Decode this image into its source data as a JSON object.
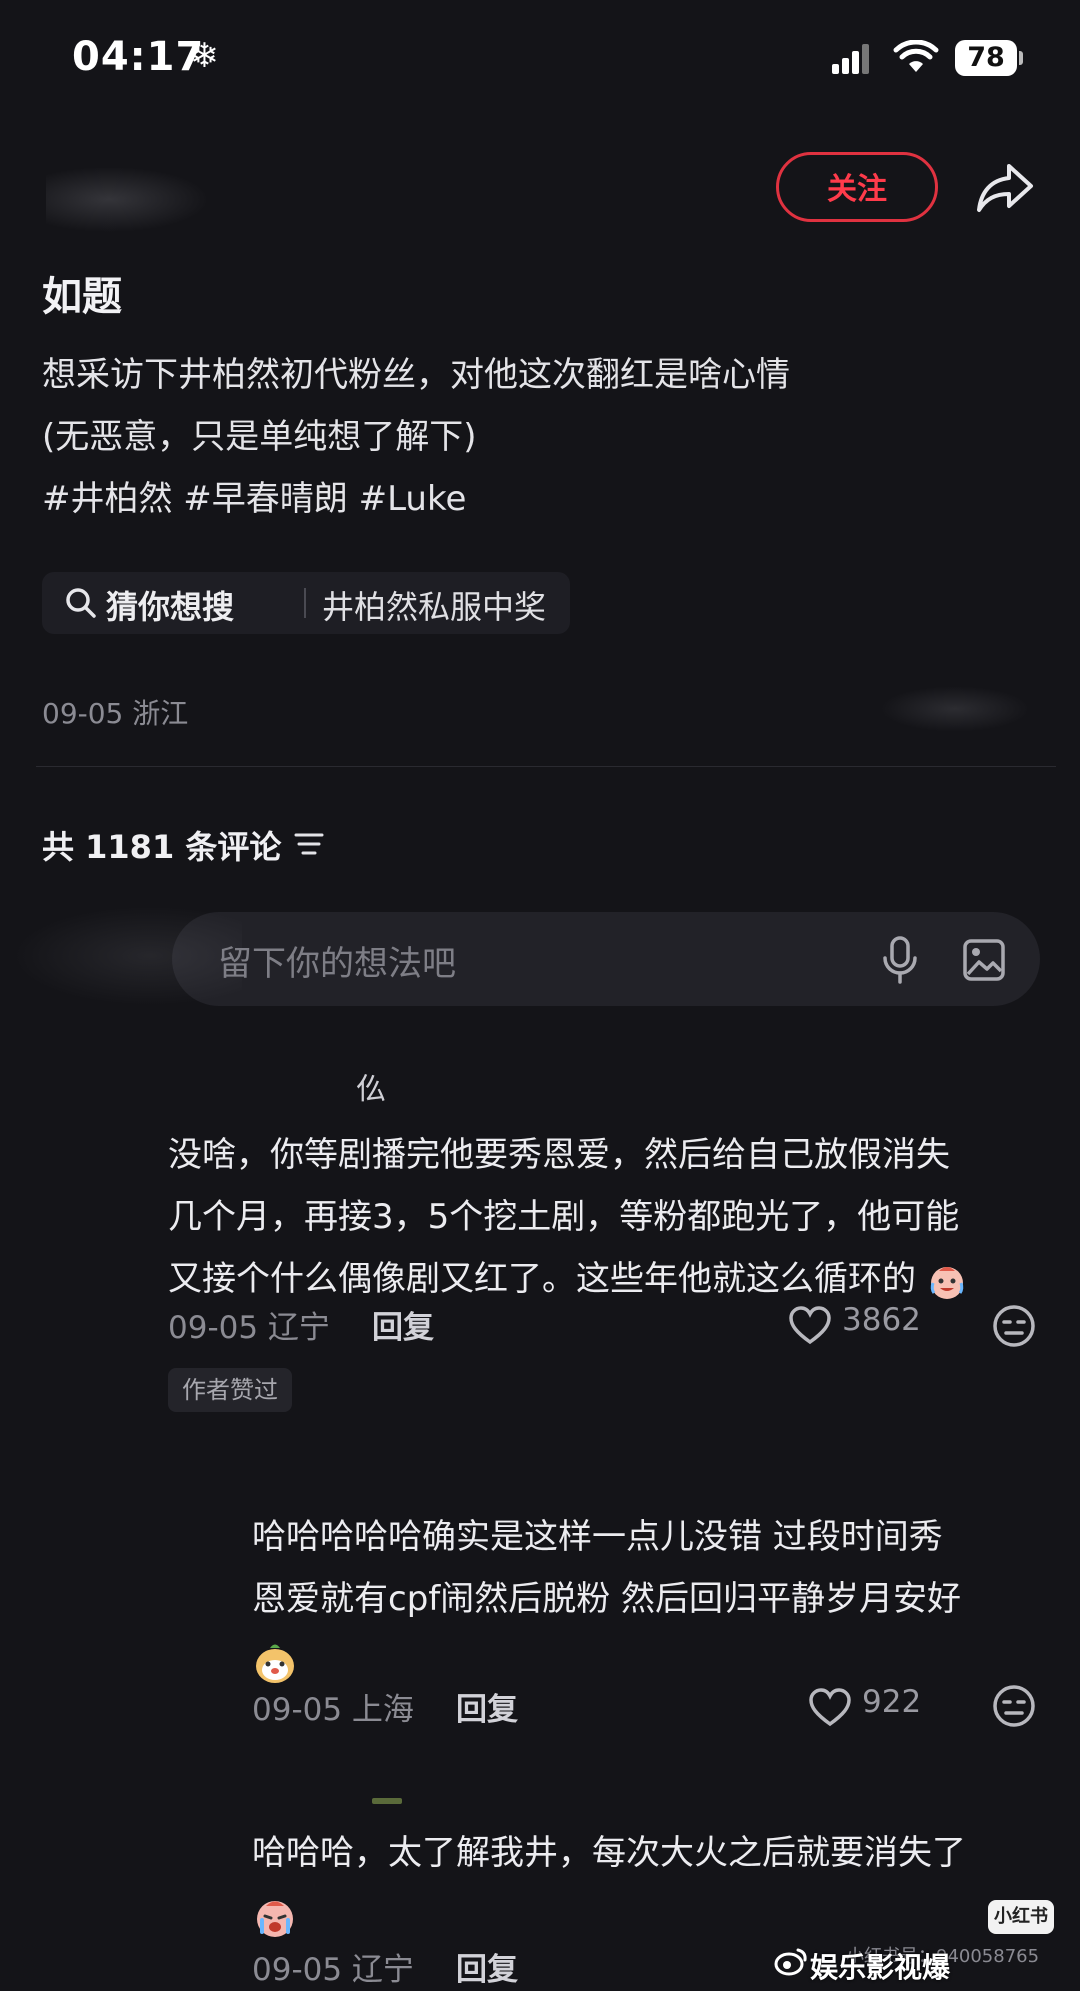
{
  "status_bar": {
    "time": "04:17",
    "snow_glyph": "❄",
    "battery": "78"
  },
  "header": {
    "follow_label": "关注",
    "share_icon": "share-arrow-icon"
  },
  "post": {
    "title": "如题",
    "body_lines": [
      "想采访下井柏然初代粉丝，对他这次翻红是啥心情",
      "(无恶意，只是单纯想了解下)",
      "#井柏然 #早春晴朗 #Luke"
    ],
    "search_chip": {
      "label": "猜你想搜",
      "term": "井柏然私服中奖"
    },
    "date_location": "09-05 浙江"
  },
  "comments_section": {
    "count_label": "共 1181 条评论",
    "input_placeholder": "留下你的想法吧"
  },
  "comments": [
    {
      "username": "仫",
      "text_lines": [
        "没啥，你等剧播完他要秀恩爱，然后给自己放假消失",
        "几个月，再接3，5个挖土剧，等粉都跑光了，他可能",
        "又接个什么偶像剧又红了。这些年他就这么循环的"
      ],
      "date_location": "09-05 辽宁",
      "reply_label": "回复",
      "likes": "3862",
      "badge": "作者赞过"
    },
    {
      "text_lines": [
        "哈哈哈哈哈确实是这样一点儿没错 过段时间秀",
        "恩爱就有cpf闹然后脱粉 然后回归平静岁月安好"
      ],
      "date_location": "09-05 上海",
      "reply_label": "回复",
      "likes": "922"
    },
    {
      "text_lines": [
        "哈哈哈，太了解我井，每次大火之后就要消失了"
      ],
      "date_location": "09-05 辽宁",
      "reply_label": "回复"
    }
  ],
  "watermarks": {
    "xhs_badge": "小红书",
    "weibo": "娱乐影视爆",
    "small_id": "小红书号：940058765"
  }
}
